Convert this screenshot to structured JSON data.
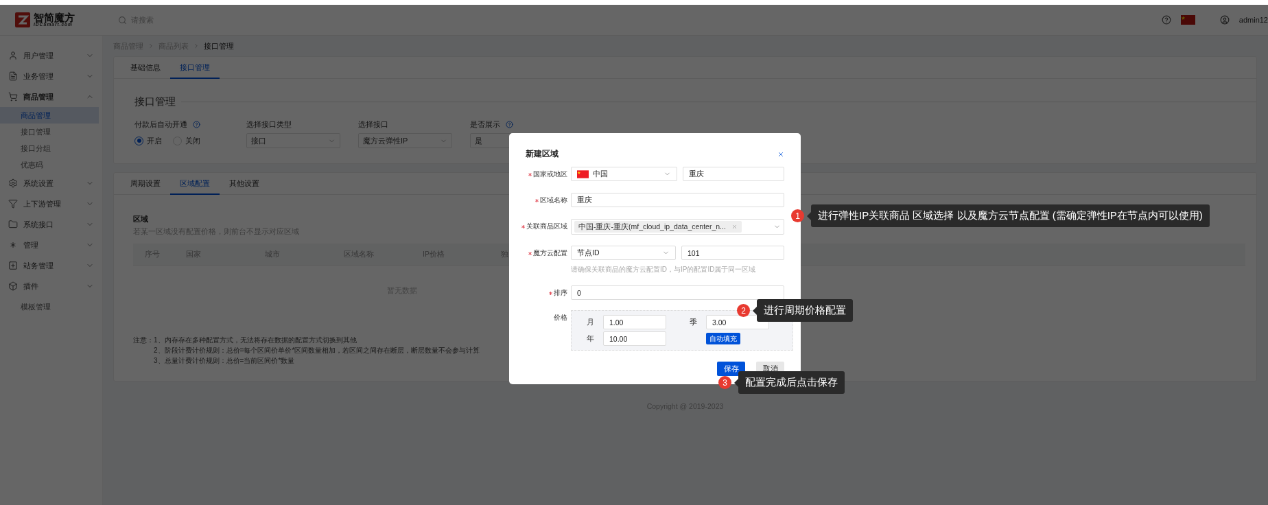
{
  "header": {
    "logo_title": "智简魔方",
    "logo_subtitle": "IDCSmart.com",
    "search_placeholder": "请搜索",
    "user": "admin12"
  },
  "sidebar": {
    "items": [
      {
        "kind": "group",
        "label": "用户管理",
        "expanded": false
      },
      {
        "kind": "group",
        "label": "业务管理",
        "expanded": false
      },
      {
        "kind": "group",
        "label": "商品管理",
        "expanded": true,
        "children": [
          {
            "label": "商品管理",
            "selected": true
          },
          {
            "label": "接口管理",
            "selected": false
          },
          {
            "label": "接口分组",
            "selected": false
          },
          {
            "label": "优惠码",
            "selected": false
          }
        ]
      },
      {
        "kind": "group",
        "label": "系统设置",
        "expanded": false
      },
      {
        "kind": "group",
        "label": "上下游管理",
        "expanded": false
      },
      {
        "kind": "group",
        "label": "系统接口",
        "expanded": false
      },
      {
        "kind": "group",
        "label": "管理",
        "expanded": false
      },
      {
        "kind": "group",
        "label": "站务管理",
        "expanded": false
      },
      {
        "kind": "group",
        "label": "插件",
        "expanded": false
      },
      {
        "kind": "link",
        "label": "模板管理"
      }
    ]
  },
  "breadcrumb": [
    "商品管理",
    "商品列表",
    "接口管理"
  ],
  "top_card": {
    "tabs": [
      {
        "label": "基础信息",
        "selected": false
      },
      {
        "label": "接口管理",
        "selected": true
      }
    ],
    "section_title": "接口管理",
    "fields": [
      {
        "kind": "radio",
        "label": "付款后自动开通",
        "help": true,
        "options": [
          {
            "label": "开启",
            "selected": true
          },
          {
            "label": "关闭",
            "selected": false
          }
        ]
      },
      {
        "kind": "select",
        "label": "选择接口类型",
        "help": false,
        "value": "接口"
      },
      {
        "kind": "select",
        "label": "选择接口",
        "help": false,
        "value": "魔方云弹性IP"
      },
      {
        "kind": "select",
        "label": "是否展示",
        "help": true,
        "value": "是"
      }
    ]
  },
  "region_card": {
    "tabs": [
      {
        "label": "周期设置",
        "selected": false
      },
      {
        "label": "区域配置",
        "selected": true
      },
      {
        "label": "其他设置",
        "selected": false
      }
    ],
    "title": "区域",
    "description": "若某一区域没有配置价格，则前台不显示对应区域",
    "table": {
      "columns": [
        "序号",
        "国家",
        "城市",
        "区域名称",
        "IP价格",
        "独"
      ],
      "empty_text": "暂无数据"
    },
    "notes_label": "注意：",
    "notes": [
      "1、内存存在多种配置方式，无法将存在数据的配置方式切换到其他",
      "2、阶段计费计价规则：总价=每个区间价单价*区间数量相加，若区间之间存在断层，断层数量不会参与计算",
      "3、总量计费计价规则：总价=当前区间价*数量"
    ]
  },
  "copyright": "Copyright @ 2019-2023",
  "modal": {
    "title": "新建区域",
    "fields": [
      {
        "kind": "country",
        "label": "国家或地区",
        "required": true,
        "select": "中国",
        "input": "重庆"
      },
      {
        "kind": "input",
        "label": "区域名称",
        "required": true,
        "value": "重庆"
      },
      {
        "kind": "tags",
        "label": "关联商品区域",
        "required": true,
        "tags": [
          "中国-重庆-重庆(mf_cloud_ip_data_center_n..."
        ]
      },
      {
        "kind": "select_input",
        "label": "魔方云配置",
        "required": true,
        "select": "节点ID",
        "input": "101",
        "hint": "请确保关联商品的魔方云配置ID，与IP的配置ID属于同一区域"
      },
      {
        "kind": "input",
        "label": "排序",
        "required": true,
        "value": "0"
      },
      {
        "kind": "price",
        "label": "价格",
        "required": false,
        "periods": [
          {
            "label": "月",
            "value": "1.00"
          },
          {
            "label": "季",
            "value": "3.00"
          },
          {
            "label": "年",
            "value": "10.00"
          }
        ],
        "autofill": "自动填充"
      }
    ],
    "buttons": [
      {
        "kind": "primary",
        "label": "保存"
      },
      {
        "kind": "secondary",
        "label": "取消"
      }
    ]
  },
  "annotations": [
    {
      "number": "1",
      "text": "进行弹性IP关联商品 区域选择 以及魔方云节点配置 (需确定弹性IP在节点内可以使用)"
    },
    {
      "number": "2",
      "text": "进行周期价格配置"
    },
    {
      "number": "3",
      "text": "配置完成后点击保存"
    }
  ]
}
